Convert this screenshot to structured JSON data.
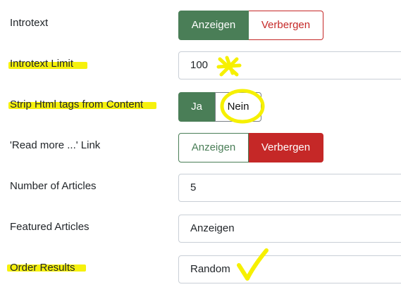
{
  "rows": [
    {
      "label": "Introtext",
      "options": [
        "Anzeigen",
        "Verbergen"
      ],
      "selected": "Anzeigen"
    },
    {
      "label": "Introtext Limit",
      "value": "100"
    },
    {
      "label": "Strip Html tags from Content",
      "options": [
        "Ja",
        "Nein"
      ],
      "selected": "Ja"
    },
    {
      "label": "'Read more ...' Link",
      "options": [
        "Anzeigen",
        "Verbergen"
      ],
      "selected": "Verbergen"
    },
    {
      "label": "Number of Articles",
      "value": "5"
    },
    {
      "label": "Featured Articles",
      "value": "Anzeigen"
    },
    {
      "label": "Order Results",
      "value": "Random"
    }
  ],
  "annotation_color": "#f6f000"
}
